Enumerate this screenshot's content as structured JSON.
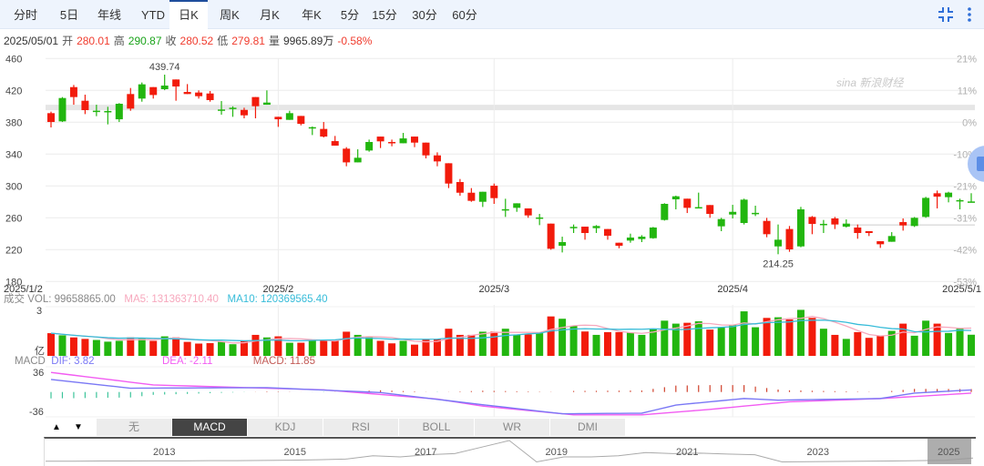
{
  "tabs": [
    {
      "label": "分时"
    },
    {
      "label": "5日"
    },
    {
      "label": "年线"
    },
    {
      "label": "YTD"
    },
    {
      "label": "日K",
      "selected": true
    },
    {
      "label": "周K"
    },
    {
      "label": "月K"
    },
    {
      "label": "年K"
    },
    {
      "label": "5分"
    },
    {
      "label": "15分"
    },
    {
      "label": "30分"
    },
    {
      "label": "60分"
    }
  ],
  "toolbar_icons": [
    "compress-icon",
    "more-vertical-icon"
  ],
  "quote": {
    "date": "2025/05/01",
    "open_label": "开",
    "open": "280.01",
    "high_label": "高",
    "high": "290.87",
    "close_label": "收",
    "close": "280.52",
    "low_label": "低",
    "low": "279.81",
    "volume_label": "量",
    "volume": "9965.89万",
    "change": "-0.58%"
  },
  "watermark": "sina 新浪财经",
  "colors": {
    "up": "#22b60f",
    "down": "#f21b0b",
    "ma5": "#f7a8bd",
    "ma10": "#37bcd9",
    "dif": "#7a78f5",
    "dea": "#f25cf2",
    "macd_label": "#c25a55",
    "hist_pos": "#d0402a",
    "hist_neg": "#3cc49a",
    "accent": "#1f4e9c"
  },
  "volume_legend": {
    "title": "成交",
    "vol": "VOL: 99658865.00",
    "ma5": "MA5: 131363710.40",
    "ma10": "MA10: 120369565.40",
    "axis_top": "3",
    "unit": "亿"
  },
  "macd_legend": {
    "title": "MACD",
    "dif": "DIF: 3.82",
    "dea": "DEA: -2.11",
    "macd": "MACD: 11.85",
    "axis_top": "36",
    "axis_bottom": "-36"
  },
  "indicator_tabs": [
    {
      "label": "无"
    },
    {
      "label": "MACD",
      "selected": true
    },
    {
      "label": "KDJ"
    },
    {
      "label": "RSI"
    },
    {
      "label": "BOLL"
    },
    {
      "label": "WR"
    },
    {
      "label": "DMI"
    }
  ],
  "navigator_years": [
    "2013",
    "2015",
    "2017",
    "2019",
    "2021",
    "2023",
    "2025"
  ],
  "chart_data": {
    "type": "candlestick",
    "price_axis": {
      "ticks": [
        "460",
        "420",
        "380",
        "340",
        "300",
        "260",
        "220",
        "180"
      ],
      "ylim": [
        180,
        460
      ]
    },
    "percent_axis": {
      "ticks": [
        "21%",
        "11%",
        "0%",
        "-10%",
        "-21%",
        "-31%",
        "-42%",
        "-53%"
      ]
    },
    "x_ticks": [
      {
        "label": "2025/1/2",
        "index": 0
      },
      {
        "label": "2025/2",
        "index": 20
      },
      {
        "label": "2025/3",
        "index": 39
      },
      {
        "label": "2025/4",
        "index": 60
      },
      {
        "label": "2025/5/1",
        "index": 81
      }
    ],
    "annotations": [
      {
        "label": "439.74",
        "index": 10,
        "position": "above"
      },
      {
        "label": "214.25",
        "index": 64,
        "position": "below"
      }
    ],
    "grid": true,
    "ohlc_order": [
      "open",
      "high",
      "low",
      "close"
    ],
    "candles": [
      [
        391.4,
        393.3,
        373.5,
        380.3
      ],
      [
        381.1,
        411.6,
        380.3,
        410.4
      ],
      [
        424.1,
        426.8,
        402.0,
        411.6
      ],
      [
        407.0,
        414.6,
        390.2,
        395.2
      ],
      [
        394.0,
        402.0,
        387.6,
        394.5
      ],
      [
        393.6,
        399.4,
        377.3,
        394.1
      ],
      [
        383.7,
        404.0,
        380.3,
        403.2
      ],
      [
        415.4,
        423.0,
        394.4,
        397.1
      ],
      [
        409.7,
        429.9,
        405.8,
        427.6
      ],
      [
        424.1,
        424.1,
        409.7,
        414.2
      ],
      [
        421.5,
        439.74,
        420.3,
        426.0
      ],
      [
        433.7,
        433.7,
        407.0,
        424.9
      ],
      [
        418.0,
        427.9,
        415.4,
        415.4
      ],
      [
        417.3,
        420.0,
        409.7,
        412.7
      ],
      [
        416.1,
        419.2,
        405.8,
        407.8
      ],
      [
        395.5,
        406.6,
        389.5,
        396.0
      ],
      [
        398.0,
        400.0,
        386.8,
        398.2
      ],
      [
        395.5,
        398.2,
        384.9,
        388.7
      ],
      [
        411.6,
        411.6,
        384.9,
        400.1
      ],
      [
        402.0,
        420.0,
        402.0,
        404.7
      ],
      [
        386.8,
        386.8,
        374.2,
        383.7
      ],
      [
        383.0,
        394.4,
        383.0,
        391.4
      ],
      [
        387.9,
        387.9,
        376.1,
        378.0
      ],
      [
        373.6,
        374.6,
        363.9,
        373.8
      ],
      [
        371.6,
        380.3,
        360.9,
        362.0
      ],
      [
        356.3,
        362.8,
        350.6,
        350.6
      ],
      [
        346.8,
        348.7,
        324.7,
        329.6
      ],
      [
        329.6,
        346.0,
        329.6,
        335.4
      ],
      [
        344.5,
        358.2,
        343.0,
        355.2
      ],
      [
        362.0,
        362.0,
        347.6,
        356.0
      ],
      [
        355.2,
        358.2,
        349.8,
        354.8
      ],
      [
        353.6,
        366.6,
        353.6,
        359.7
      ],
      [
        362.0,
        362.0,
        348.7,
        354.4
      ],
      [
        354.4,
        354.4,
        334.6,
        338.4
      ],
      [
        338.4,
        342.2,
        324.7,
        330.8
      ],
      [
        328.5,
        328.5,
        297.3,
        303.0
      ],
      [
        304.9,
        308.7,
        287.7,
        291.5
      ],
      [
        291.5,
        297.3,
        280.1,
        281.3
      ],
      [
        280.1,
        292.7,
        273.6,
        292.7
      ],
      [
        300.3,
        303.0,
        277.5,
        284.7
      ],
      [
        270.6,
        283.9,
        261.1,
        270.8
      ],
      [
        272.5,
        278.2,
        267.5,
        278.2
      ],
      [
        271.8,
        271.8,
        260.0,
        263.0
      ],
      [
        260.1,
        264.9,
        250.8,
        260.4
      ],
      [
        252.7,
        252.7,
        219.9,
        221.1
      ],
      [
        224.9,
        236.3,
        216.5,
        229.5
      ],
      [
        248.5,
        251.6,
        240.9,
        248.6
      ],
      [
        248.9,
        248.9,
        232.5,
        240.9
      ],
      [
        247.0,
        250.8,
        240.9,
        249.7
      ],
      [
        245.9,
        245.9,
        232.5,
        237.5
      ],
      [
        228.7,
        228.7,
        221.8,
        224.9
      ],
      [
        231.4,
        240.1,
        228.7,
        235.2
      ],
      [
        233.3,
        238.2,
        229.5,
        236.3
      ],
      [
        234.4,
        248.5,
        233.7,
        247.8
      ],
      [
        257.3,
        278.3,
        256.5,
        277.5
      ],
      [
        283.2,
        287.8,
        270.6,
        287.0
      ],
      [
        284.0,
        284.0,
        266.0,
        272.5
      ],
      [
        273.3,
        291.6,
        271.8,
        273.4
      ],
      [
        276.0,
        276.0,
        260.0,
        264.9
      ],
      [
        249.3,
        260.0,
        243.2,
        258.4
      ],
      [
        264.1,
        276.3,
        259.2,
        267.5
      ],
      [
        253.5,
        284.0,
        251.6,
        282.8
      ],
      [
        266.0,
        275.2,
        262.2,
        266.2
      ],
      [
        256.1,
        259.9,
        235.6,
        239.4
      ],
      [
        224.1,
        251.6,
        214.25,
        232.5
      ],
      [
        245.9,
        249.7,
        217.3,
        220.3
      ],
      [
        224.1,
        273.7,
        223.0,
        270.6
      ],
      [
        261.1,
        262.2,
        239.4,
        252.3
      ],
      [
        252.3,
        257.3,
        240.9,
        252.4
      ],
      [
        259.2,
        261.1,
        245.9,
        251.6
      ],
      [
        248.9,
        258.0,
        247.8,
        252.7
      ],
      [
        247.8,
        251.6,
        233.7,
        240.9
      ],
      [
        243.2,
        243.2,
        237.1,
        240.9
      ],
      [
        230.6,
        230.6,
        222.2,
        226.8
      ],
      [
        229.9,
        242.0,
        229.9,
        237.1
      ],
      [
        254.6,
        259.2,
        243.9,
        250.4
      ],
      [
        249.7,
        261.0,
        248.5,
        260.0
      ],
      [
        261.1,
        286.3,
        260.0,
        285.0
      ],
      [
        290.8,
        294.2,
        271.8,
        286.6
      ],
      [
        285.9,
        292.7,
        279.4,
        291.6
      ],
      [
        282.0,
        284.0,
        270.6,
        282.2
      ],
      [
        280.01,
        290.87,
        279.81,
        280.52
      ]
    ],
    "volume_unit": "亿",
    "volume": [
      1.07,
      0.97,
      0.87,
      0.8,
      0.75,
      0.67,
      0.71,
      0.87,
      0.85,
      0.71,
      0.92,
      0.87,
      0.66,
      0.58,
      0.6,
      0.66,
      0.55,
      0.71,
      0.99,
      0.87,
      0.92,
      0.62,
      0.62,
      0.77,
      0.75,
      0.75,
      1.14,
      0.99,
      0.89,
      0.71,
      0.59,
      0.71,
      0.53,
      0.77,
      0.8,
      1.28,
      0.99,
      0.99,
      1.14,
      1.14,
      1.28,
      0.99,
      1.01,
      1.07,
      1.86,
      1.75,
      1.42,
      1.15,
      0.99,
      1.12,
      1.12,
      1.09,
      0.99,
      1.29,
      1.66,
      1.52,
      1.56,
      1.63,
      1.24,
      1.35,
      1.46,
      2.1,
      1.35,
      1.79,
      1.82,
      1.72,
      2.17,
      1.79,
      1.28,
      0.99,
      0.8,
      1.12,
      0.85,
      0.94,
      1.18,
      1.52,
      0.95,
      1.66,
      1.52,
      1.08,
      1.28,
      0.997
    ],
    "macd": {
      "ylim": [
        -36,
        36
      ],
      "dif": [
        23,
        20.7,
        18.4,
        16.1,
        13.9,
        11.6,
        9.3,
        7,
        7.1,
        7.2,
        7.3,
        7.3,
        7.4,
        7.5,
        7.6,
        7.7,
        7.8,
        7.8,
        7.9,
        8,
        7.1,
        6.2,
        5.3,
        4.4,
        3.5,
        2.6,
        1.7,
        0.8,
        -0.1,
        -1,
        -3.5,
        -6,
        -8.5,
        -11,
        -13.5,
        -16,
        -18.5,
        -21,
        -23.4,
        -25.8,
        -28.1,
        -30.5,
        -32.9,
        -35.3,
        -37.6,
        -40,
        -39.9,
        -39.7,
        -39.6,
        -39.4,
        -39.3,
        -39.1,
        -39,
        -34,
        -29,
        -24,
        -22,
        -20,
        -18,
        -16,
        -14,
        -12,
        -13,
        -14,
        -15,
        -14.7,
        -14.3,
        -14,
        -13.7,
        -13.3,
        -13,
        -12.7,
        -12.3,
        -12,
        -8.7,
        -5.3,
        -2,
        -0.84,
        0.33,
        1.49,
        2.66,
        3.82
      ],
      "dea": [
        36,
        33.4,
        30.9,
        28.3,
        25.8,
        23.2,
        20.7,
        18.1,
        15.6,
        13,
        12.4,
        11.8,
        11.2,
        10.6,
        10,
        9.4,
        8.8,
        8.2,
        7.6,
        7,
        6.4,
        5.8,
        5.2,
        4.6,
        4,
        2.3,
        0.6,
        -1.1,
        -2.8,
        -4.5,
        -6.2,
        -7.9,
        -9.6,
        -11.3,
        -13,
        -16.3,
        -19.5,
        -22.8,
        -26,
        -28,
        -30,
        -32,
        -34,
        -36,
        -38,
        -40,
        -42,
        -42,
        -42,
        -42,
        -42,
        -42,
        -42,
        -40.3,
        -38.7,
        -37,
        -35.3,
        -33.7,
        -32,
        -30,
        -28,
        -26,
        -24,
        -22,
        -20,
        -18,
        -17.3,
        -16.5,
        -15.8,
        -15,
        -14.3,
        -13.5,
        -12.8,
        -12,
        -10.8,
        -9.5,
        -8.3,
        -7.1,
        -5.8,
        -4.6,
        -3.3,
        -2.11
      ]
    },
    "overview_line": [
      0.05,
      0.05,
      0.06,
      0.06,
      0.07,
      0.07,
      0.08,
      0.08,
      0.09,
      0.1,
      0.12,
      0.15,
      0.3,
      0.25,
      0.35,
      0.4,
      0.7,
      1.0,
      0.02,
      0.25,
      0.25,
      0.3,
      0.45,
      0.4,
      0.42,
      0.38,
      0.35,
      0.02,
      0.03,
      0.04,
      0.05,
      0.06,
      0.08,
      0.1,
      0.2
    ]
  }
}
